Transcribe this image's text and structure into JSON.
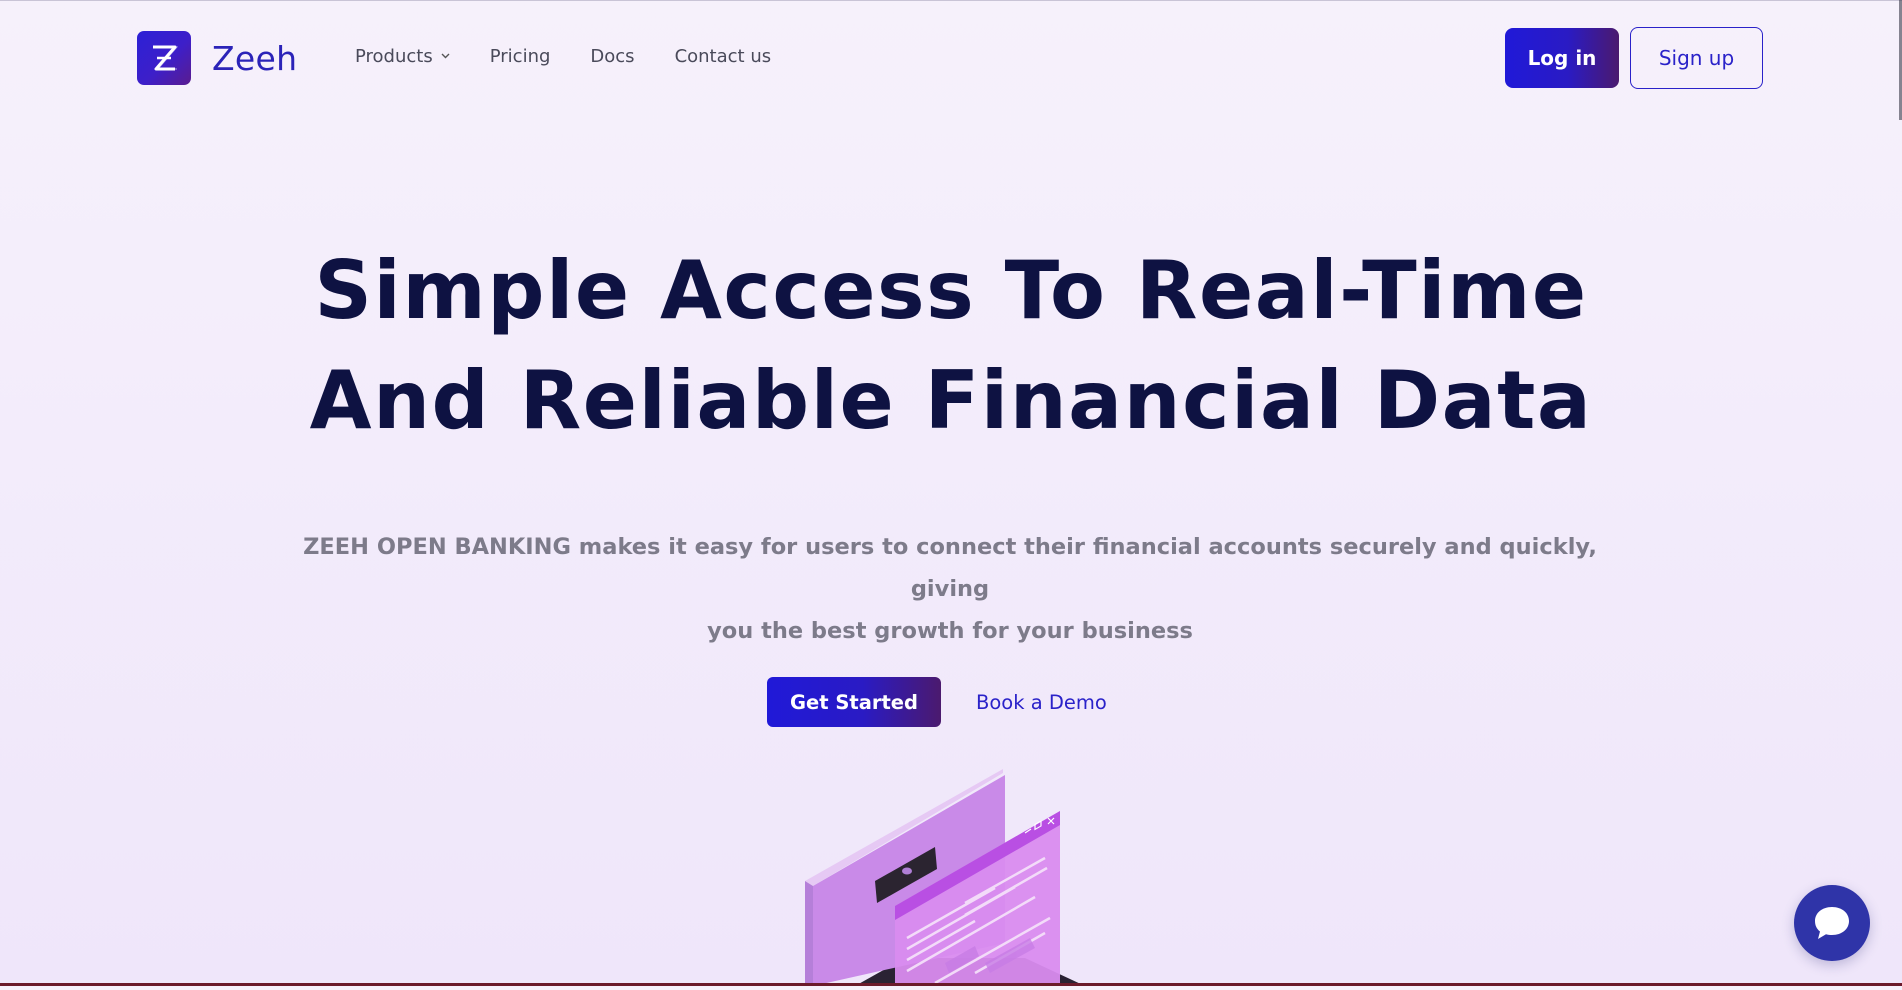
{
  "brand": {
    "name": "Zeeh",
    "logo_letter": "Z"
  },
  "nav": {
    "items": [
      {
        "label": "Products",
        "has_dropdown": true
      },
      {
        "label": "Pricing"
      },
      {
        "label": "Docs"
      },
      {
        "label": "Contact us"
      }
    ]
  },
  "auth": {
    "login_label": "Log in",
    "signup_label": "Sign up"
  },
  "hero": {
    "title_line1": "Simple Access To Real-Time",
    "title_line2": "And Reliable Financial Data",
    "subtitle_line1": "ZEEH OPEN BANKING makes it easy for users to connect their financial accounts securely and quickly, giving",
    "subtitle_line2": "you the best growth for your business",
    "cta_primary": "Get Started",
    "cta_secondary": "Book a Demo"
  },
  "icons": {
    "dropdown": "chevron-down-icon",
    "chat": "chat-bubble-icon",
    "illustration": "laptop-illustration"
  },
  "colors": {
    "brand_primary": "#2019d8",
    "brand_secondary": "#4b1a6e",
    "title": "#0e1242",
    "subtitle": "#7d7b8a",
    "chat_bg": "#2f34a8"
  }
}
